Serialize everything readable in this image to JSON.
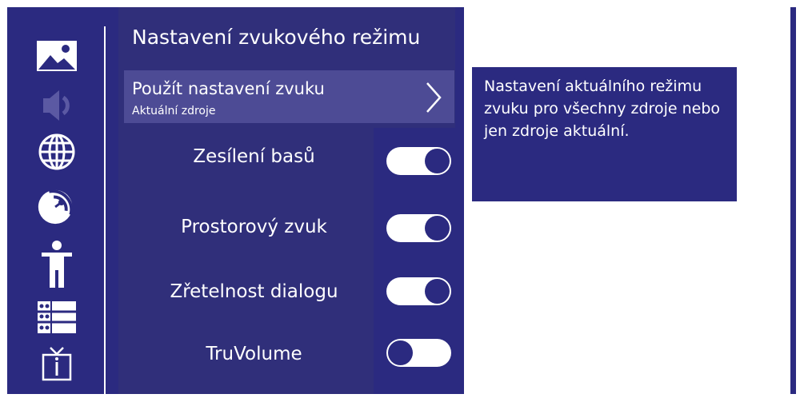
{
  "header": {
    "title": "Nastavení zvukového režimu"
  },
  "sidebar": {
    "icons": [
      {
        "name": "picture-icon",
        "active": false
      },
      {
        "name": "sound-icon",
        "active": true
      },
      {
        "name": "globe-icon",
        "active": false
      },
      {
        "name": "satellite-icon",
        "active": false
      },
      {
        "name": "accessibility-icon",
        "active": false
      },
      {
        "name": "list-icon",
        "active": false
      },
      {
        "name": "tv-info-icon",
        "active": false
      }
    ]
  },
  "nav_row": {
    "label": "Použít nastavení zvuku",
    "sublabel": "Aktuální zdroje",
    "icon": "chevron-right-icon"
  },
  "settings": [
    {
      "label": "Zesílení basů",
      "enabled": true
    },
    {
      "label": "Prostorový zvuk",
      "enabled": true
    },
    {
      "label": "Zřetelnost dialogu",
      "enabled": true
    },
    {
      "label": "TruVolume",
      "enabled": false
    }
  ],
  "info": {
    "text": "Nastavení aktuálního režimu zvuku pro všechny zdroje nebo jen zdroje aktuální."
  },
  "colors": {
    "background": "#2b2a80",
    "panel": "#302f7a",
    "highlight": "#4d4b95",
    "inactive_icon": "#5b59a3",
    "foreground": "#ffffff"
  }
}
